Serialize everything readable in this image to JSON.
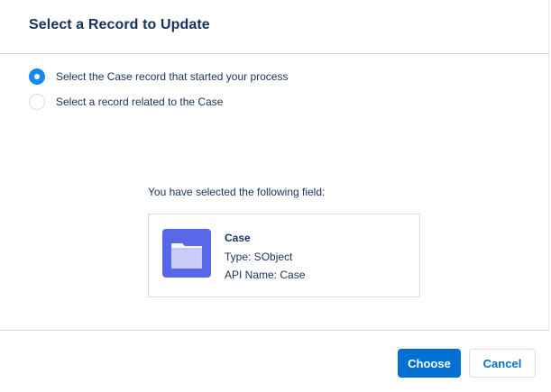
{
  "modal": {
    "title": "Select a Record to Update"
  },
  "options": [
    {
      "label": "Select the Case record that started your process",
      "checked": true
    },
    {
      "label": "Select a record related to the Case",
      "checked": false
    }
  ],
  "selection": {
    "caption": "You have selected the following field:",
    "field": {
      "icon": "folder-icon",
      "icon_color": "#5867e8",
      "name": "Case",
      "type_label": "Type: SObject",
      "api_label": "API Name: Case"
    }
  },
  "footer": {
    "choose_label": "Choose",
    "cancel_label": "Cancel"
  },
  "colors": {
    "brand": "#0070d2",
    "radio_selected": "#1589ee",
    "text": "#16325c"
  }
}
